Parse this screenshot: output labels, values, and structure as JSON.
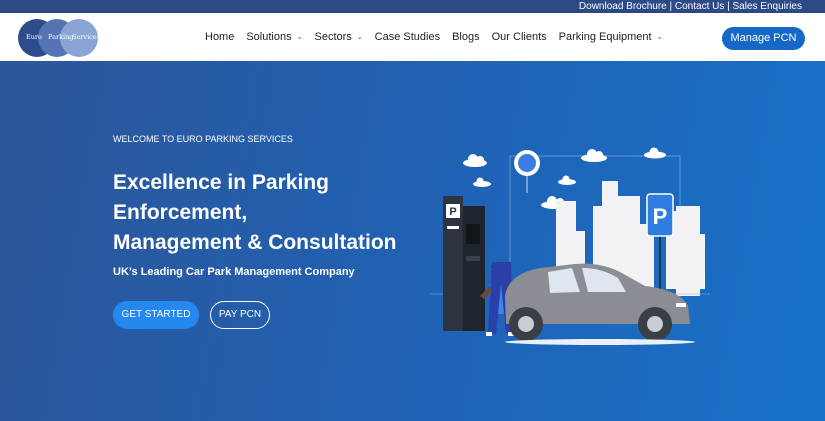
{
  "topbar": {
    "download": "Download Brochure",
    "sep1": " | ",
    "contact": "Contact Us",
    "sep2": " | ",
    "sales": "Sales Enquiries"
  },
  "logo": {
    "word1": "Euro",
    "word2": "Parking",
    "word3": "Services"
  },
  "nav": {
    "home": "Home",
    "solutions": "Solutions",
    "sectors": "Sectors",
    "case_studies": "Case Studies",
    "blogs": "Blogs",
    "our_clients": "Our Clients",
    "parking_equipment": "Parking Equipment",
    "chevron": "⌄"
  },
  "header_button": "Manage PCN",
  "hero": {
    "welcome": "WELCOME TO EURO PARKING SERVICES",
    "headline_1": "Excellence in Parking",
    "headline_2": "Enforcement,",
    "headline_3": "Management & Consultation",
    "subheadline": "UK’s Leading Car Park Management Company",
    "primary_button": "GET STARTED",
    "secondary_button": "PAY PCN",
    "sign_letter": "P"
  },
  "colors": {
    "topbar": "#2b4a86",
    "accent": "#1668c7",
    "hero_start": "#2d5698",
    "hero_end": "#1872c9",
    "button_primary": "#2588f0"
  }
}
